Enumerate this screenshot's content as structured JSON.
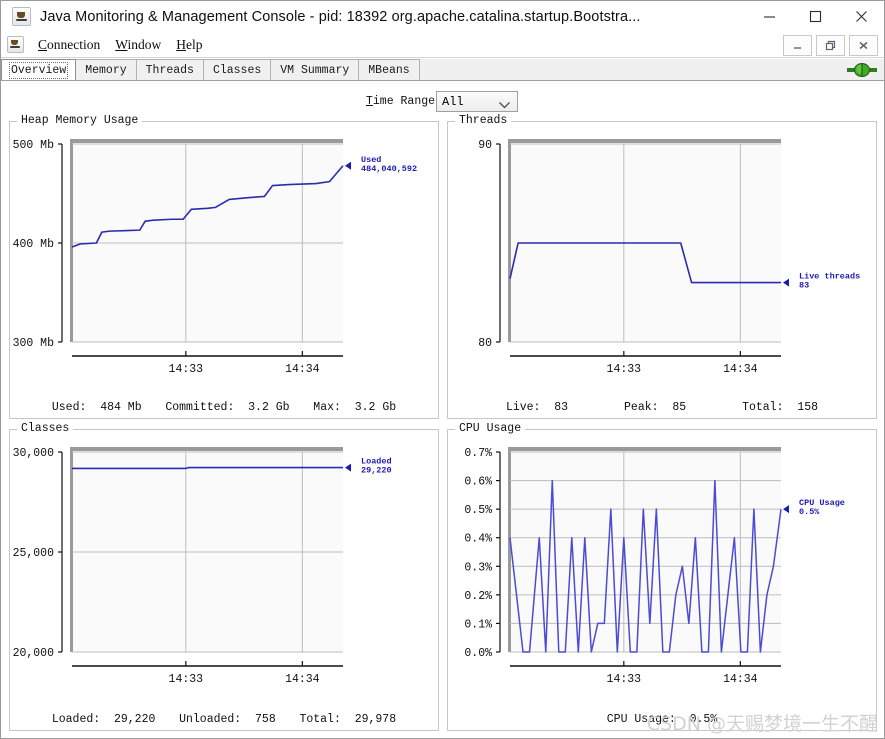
{
  "window": {
    "title": "Java Monitoring & Management Console - pid: 18392 org.apache.catalina.startup.Bootstra...",
    "app_icon": "java-cup-icon",
    "minimize_label": "—",
    "maximize_label": "□",
    "close_label": "✕"
  },
  "menubar": {
    "icon": "java-cup-icon",
    "items": [
      {
        "label": "Connection",
        "mnemonic": "C"
      },
      {
        "label": "Window",
        "mnemonic": "W"
      },
      {
        "label": "Help",
        "mnemonic": "H"
      }
    ],
    "internal_frame_buttons": {
      "minimize": "_",
      "restore": "❐",
      "close": "✕"
    }
  },
  "tabs": {
    "items": [
      "Overview",
      "Memory",
      "Threads",
      "Classes",
      "VM Summary",
      "MBeans"
    ],
    "active": "Overview",
    "connection_indicator": "green-connected-icon"
  },
  "toolbar": {
    "time_range_label": "Time Range:",
    "time_range_mnemonic": "T",
    "time_range_value": "All"
  },
  "watermark": "CSDN @天赐梦境一生不醒",
  "colors": {
    "series_line": "#2b2bb0",
    "cpu_line": "#4b4bd4",
    "legend_text": "#1a1ab4",
    "grid": "#bdbdbd",
    "plot_bg": "#fafafa",
    "panel_border": "#c8c8c8"
  },
  "chart_data": [
    {
      "id": "heap-memory-usage",
      "type": "line",
      "title": "Heap Memory Usage",
      "xlabel": "",
      "ylabel": "",
      "ylim": [
        300,
        500
      ],
      "yticks": [
        300,
        400,
        500
      ],
      "ytick_labels": [
        "300 Mb",
        "400 Mb",
        "500 Mb"
      ],
      "xticks": [
        "14:33",
        "14:34"
      ],
      "xtick_positions": [
        0.42,
        0.85
      ],
      "grid": true,
      "legend_position": "right",
      "legend": {
        "name": "Used",
        "value": "484,040,592"
      },
      "series": [
        {
          "name": "Used",
          "x": [
            0.0,
            0.03,
            0.09,
            0.11,
            0.14,
            0.25,
            0.27,
            0.3,
            0.37,
            0.41,
            0.44,
            0.5,
            0.53,
            0.58,
            0.62,
            0.66,
            0.71,
            0.74,
            0.8,
            0.9,
            0.95,
            1.0
          ],
          "values": [
            396,
            399,
            400,
            411,
            412,
            413,
            422,
            423,
            424,
            424,
            434,
            435,
            436,
            444,
            445,
            446,
            447,
            458,
            459,
            460,
            462,
            478
          ]
        }
      ],
      "footer": [
        {
          "label": "Used:",
          "value": "484 Mb"
        },
        {
          "label": "Committed:",
          "value": "3.2 Gb"
        },
        {
          "label": "Max:",
          "value": "3.2 Gb"
        }
      ]
    },
    {
      "id": "threads",
      "type": "line",
      "title": "Threads",
      "xlabel": "",
      "ylabel": "",
      "ylim": [
        80,
        90
      ],
      "yticks": [
        80,
        90
      ],
      "ytick_labels": [
        "80",
        "90"
      ],
      "xticks": [
        "14:33",
        "14:34"
      ],
      "xtick_positions": [
        0.42,
        0.85
      ],
      "grid": true,
      "legend_position": "right",
      "legend": {
        "name": "Live threads",
        "value": "83"
      },
      "series": [
        {
          "name": "Live threads",
          "x": [
            0.0,
            0.03,
            0.42,
            0.63,
            0.67,
            1.0
          ],
          "values": [
            83.2,
            85.0,
            85.0,
            85.0,
            83.0,
            83.0
          ]
        }
      ],
      "footer": [
        {
          "label": "Live:",
          "value": "83"
        },
        {
          "label": "Peak:",
          "value": "85"
        },
        {
          "label": "Total:",
          "value": "158"
        }
      ]
    },
    {
      "id": "classes",
      "type": "line",
      "title": "Classes",
      "xlabel": "",
      "ylabel": "",
      "ylim": [
        20000,
        30000
      ],
      "yticks": [
        20000,
        25000,
        30000
      ],
      "ytick_labels": [
        "20,000",
        "25,000",
        "30,000"
      ],
      "xticks": [
        "14:33",
        "14:34"
      ],
      "xtick_positions": [
        0.42,
        0.85
      ],
      "grid": true,
      "legend_position": "right",
      "legend": {
        "name": "Loaded",
        "value": "29,220"
      },
      "series": [
        {
          "name": "Loaded",
          "x": [
            0.0,
            0.42,
            0.43,
            1.0
          ],
          "values": [
            29180,
            29180,
            29220,
            29220
          ]
        }
      ],
      "footer": [
        {
          "label": "Loaded:",
          "value": "29,220"
        },
        {
          "label": "Unloaded:",
          "value": "758"
        },
        {
          "label": "Total:",
          "value": "29,978"
        }
      ]
    },
    {
      "id": "cpu-usage",
      "type": "line",
      "title": "CPU Usage",
      "xlabel": "",
      "ylabel": "",
      "ylim": [
        0.0,
        0.7
      ],
      "yticks": [
        0.0,
        0.1,
        0.2,
        0.3,
        0.4,
        0.5,
        0.6,
        0.7
      ],
      "ytick_labels": [
        "0.0%",
        "0.1%",
        "0.2%",
        "0.3%",
        "0.4%",
        "0.5%",
        "0.6%",
        "0.7%"
      ],
      "xticks": [
        "14:33",
        "14:34"
      ],
      "xtick_positions": [
        0.42,
        0.85
      ],
      "grid": true,
      "legend_position": "right",
      "legend": {
        "name": "CPU Usage",
        "value": "0.5%"
      },
      "series": [
        {
          "name": "CPU Usage",
          "x": [
            0.0,
            0.048,
            0.072,
            0.108,
            0.132,
            0.156,
            0.18,
            0.204,
            0.228,
            0.252,
            0.276,
            0.3,
            0.324,
            0.348,
            0.372,
            0.396,
            0.42,
            0.444,
            0.468,
            0.492,
            0.516,
            0.54,
            0.564,
            0.588,
            0.612,
            0.636,
            0.66,
            0.684,
            0.708,
            0.732,
            0.756,
            0.78,
            0.804,
            0.828,
            0.852,
            0.876,
            0.9,
            0.924,
            0.948,
            0.972,
            1.0
          ],
          "values": [
            0.4,
            0.0,
            0.0,
            0.4,
            0.0,
            0.6,
            0.0,
            0.0,
            0.4,
            0.0,
            0.4,
            0.0,
            0.1,
            0.1,
            0.5,
            0.0,
            0.4,
            0.0,
            0.0,
            0.5,
            0.1,
            0.5,
            0.0,
            0.0,
            0.2,
            0.3,
            0.1,
            0.4,
            0.0,
            0.0,
            0.6,
            0.0,
            0.2,
            0.4,
            0.0,
            0.0,
            0.5,
            0.0,
            0.2,
            0.3,
            0.5
          ]
        }
      ],
      "footer": [
        {
          "label": "CPU Usage:",
          "value": "0.5%"
        }
      ]
    }
  ]
}
